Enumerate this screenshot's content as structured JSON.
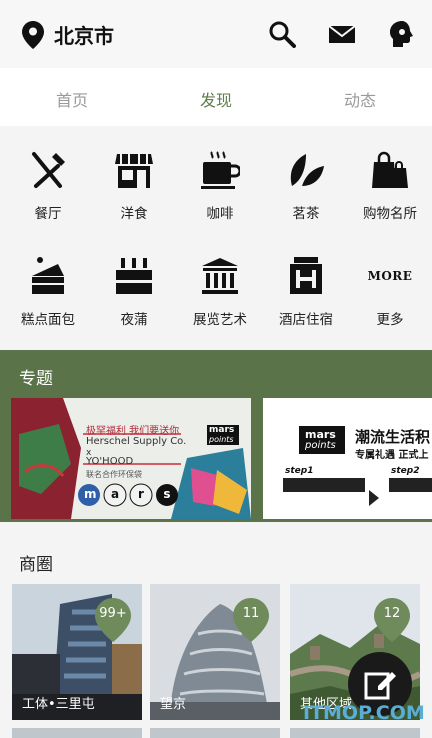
{
  "header": {
    "city": "北京市",
    "icons": [
      "location-pin-icon",
      "search-icon",
      "mail-icon",
      "profile-head-icon"
    ]
  },
  "tabs": [
    {
      "label": "首页",
      "active": false
    },
    {
      "label": "发现",
      "active": true
    },
    {
      "label": "动态",
      "active": false
    }
  ],
  "categories": [
    {
      "label": "餐厅",
      "icon": "fork-knife-icon"
    },
    {
      "label": "洋食",
      "icon": "shop-icon"
    },
    {
      "label": "咖啡",
      "icon": "coffee-cup-icon"
    },
    {
      "label": "茗茶",
      "icon": "tea-leaf-icon"
    },
    {
      "label": "购物名所",
      "icon": "shopping-bag-icon"
    },
    {
      "label": "糕点面包",
      "icon": "cake-icon"
    },
    {
      "label": "夜蒲",
      "icon": "bottles-icon"
    },
    {
      "label": "展览艺术",
      "icon": "museum-icon"
    },
    {
      "label": "酒店住宿",
      "icon": "hotel-icon"
    },
    {
      "label": "更多",
      "icon": "more-icon",
      "icon_text": "MORE"
    }
  ],
  "topics": {
    "title": "专题",
    "banner1": {
      "line1": "极罕福利 我们要送你",
      "line2": "Herschel Supply Co.",
      "line3": "x",
      "line4": "YO'HOOD",
      "line5": "联名合作环保袋",
      "logo_top": "mars",
      "logo_bottom": "points",
      "letters": [
        "m",
        "a",
        "r",
        "s"
      ]
    },
    "banner2": {
      "headline": "潮流生活积",
      "sub": "专属礼遇 正式上",
      "logo_top": "mars",
      "logo_bottom": "points",
      "step1": "step1",
      "step2": "step2"
    }
  },
  "circles": {
    "title": "商圈",
    "cards": [
      {
        "name": "工体•三里屯",
        "count": "99+"
      },
      {
        "name": "望京",
        "count": "11"
      },
      {
        "name": "其他区域",
        "count": "12"
      }
    ]
  },
  "fab": {
    "icon": "edit-pencil-icon"
  },
  "watermark": "ITMOP.COM",
  "colors": {
    "accent": "#5f7d4a",
    "topic_bg": "#5a7349",
    "tab_inactive": "#9a9a9a"
  }
}
